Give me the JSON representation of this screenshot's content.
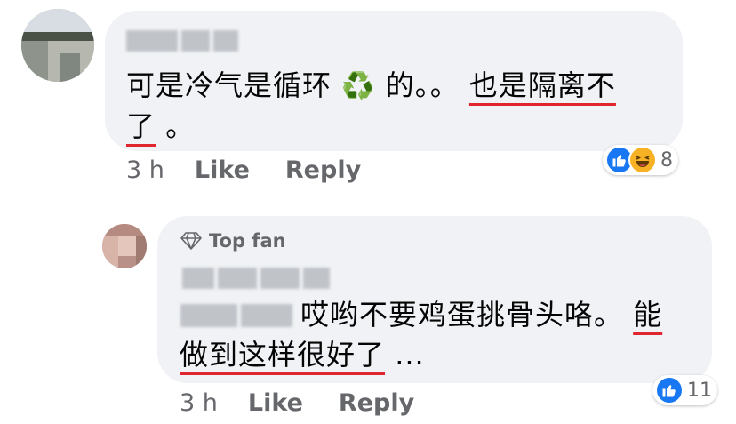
{
  "comment1": {
    "text_line1_a": "可是冷气是循环",
    "emoji": "♻️",
    "text_line1_b": "的。。",
    "text_line1_c": "也是隔离不",
    "text_line2_a": "了",
    "text_line2_b": "。",
    "time": "3 h",
    "like_label": "Like",
    "reply_label": "Reply",
    "reaction_count": "8"
  },
  "comment2": {
    "badge": "Top fan",
    "text_line1_a": "哎哟不要鸡蛋挑骨头咯。",
    "text_line1_b": "能",
    "text_line2_a": "做到这样很好了",
    "text_line2_b": "...",
    "time": "3 h",
    "like_label": "Like",
    "reply_label": "Reply",
    "reaction_count": "11"
  },
  "colors": {
    "bubble": "#f0f2f5",
    "underline": "#e0252e",
    "like_blue": "#1877f2",
    "haha_yellow": "#f7b125",
    "meta_gray": "#65676b"
  }
}
